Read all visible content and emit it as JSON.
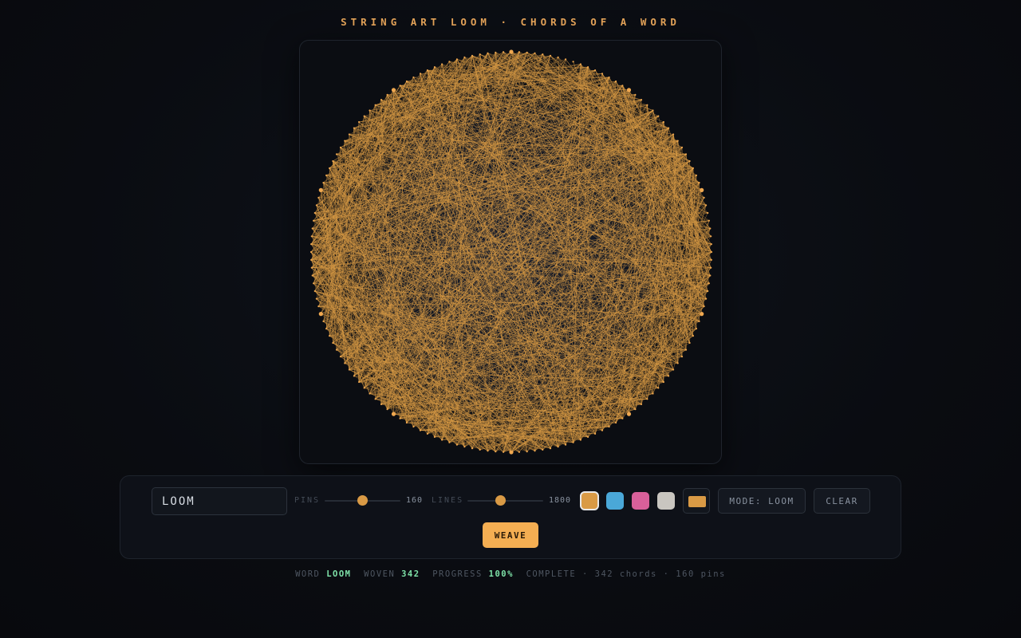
{
  "title": "STRING ART LOOM · CHORDS OF A WORD",
  "controls": {
    "word_value": "LOOM",
    "pins_label": "PINS",
    "pins_value": "160",
    "pins_level": 0.5,
    "lines_label": "LINES",
    "lines_value": "1800",
    "lines_level": 0.44,
    "swatches": [
      "#d99a45",
      "#4aa8d8",
      "#d8609a",
      "#c9c6c0"
    ],
    "selected_swatch": 0,
    "custom_color": "#d99a45",
    "mode_label": "MODE: LOOM",
    "clear_label": "CLEAR",
    "weave_label": "WEAVE"
  },
  "canvas": {
    "thread_color": "#d99a45",
    "pin_color": "#f0a850",
    "pins": 160,
    "chords": 342
  },
  "status": {
    "word_label": "WORD",
    "word_value": "LOOM",
    "woven_label": "WOVEN",
    "woven_value": "342",
    "progress_label": "PROGRESS",
    "progress_value": "100%",
    "summary": "COMPLETE · 342 chords · 160 pins"
  }
}
